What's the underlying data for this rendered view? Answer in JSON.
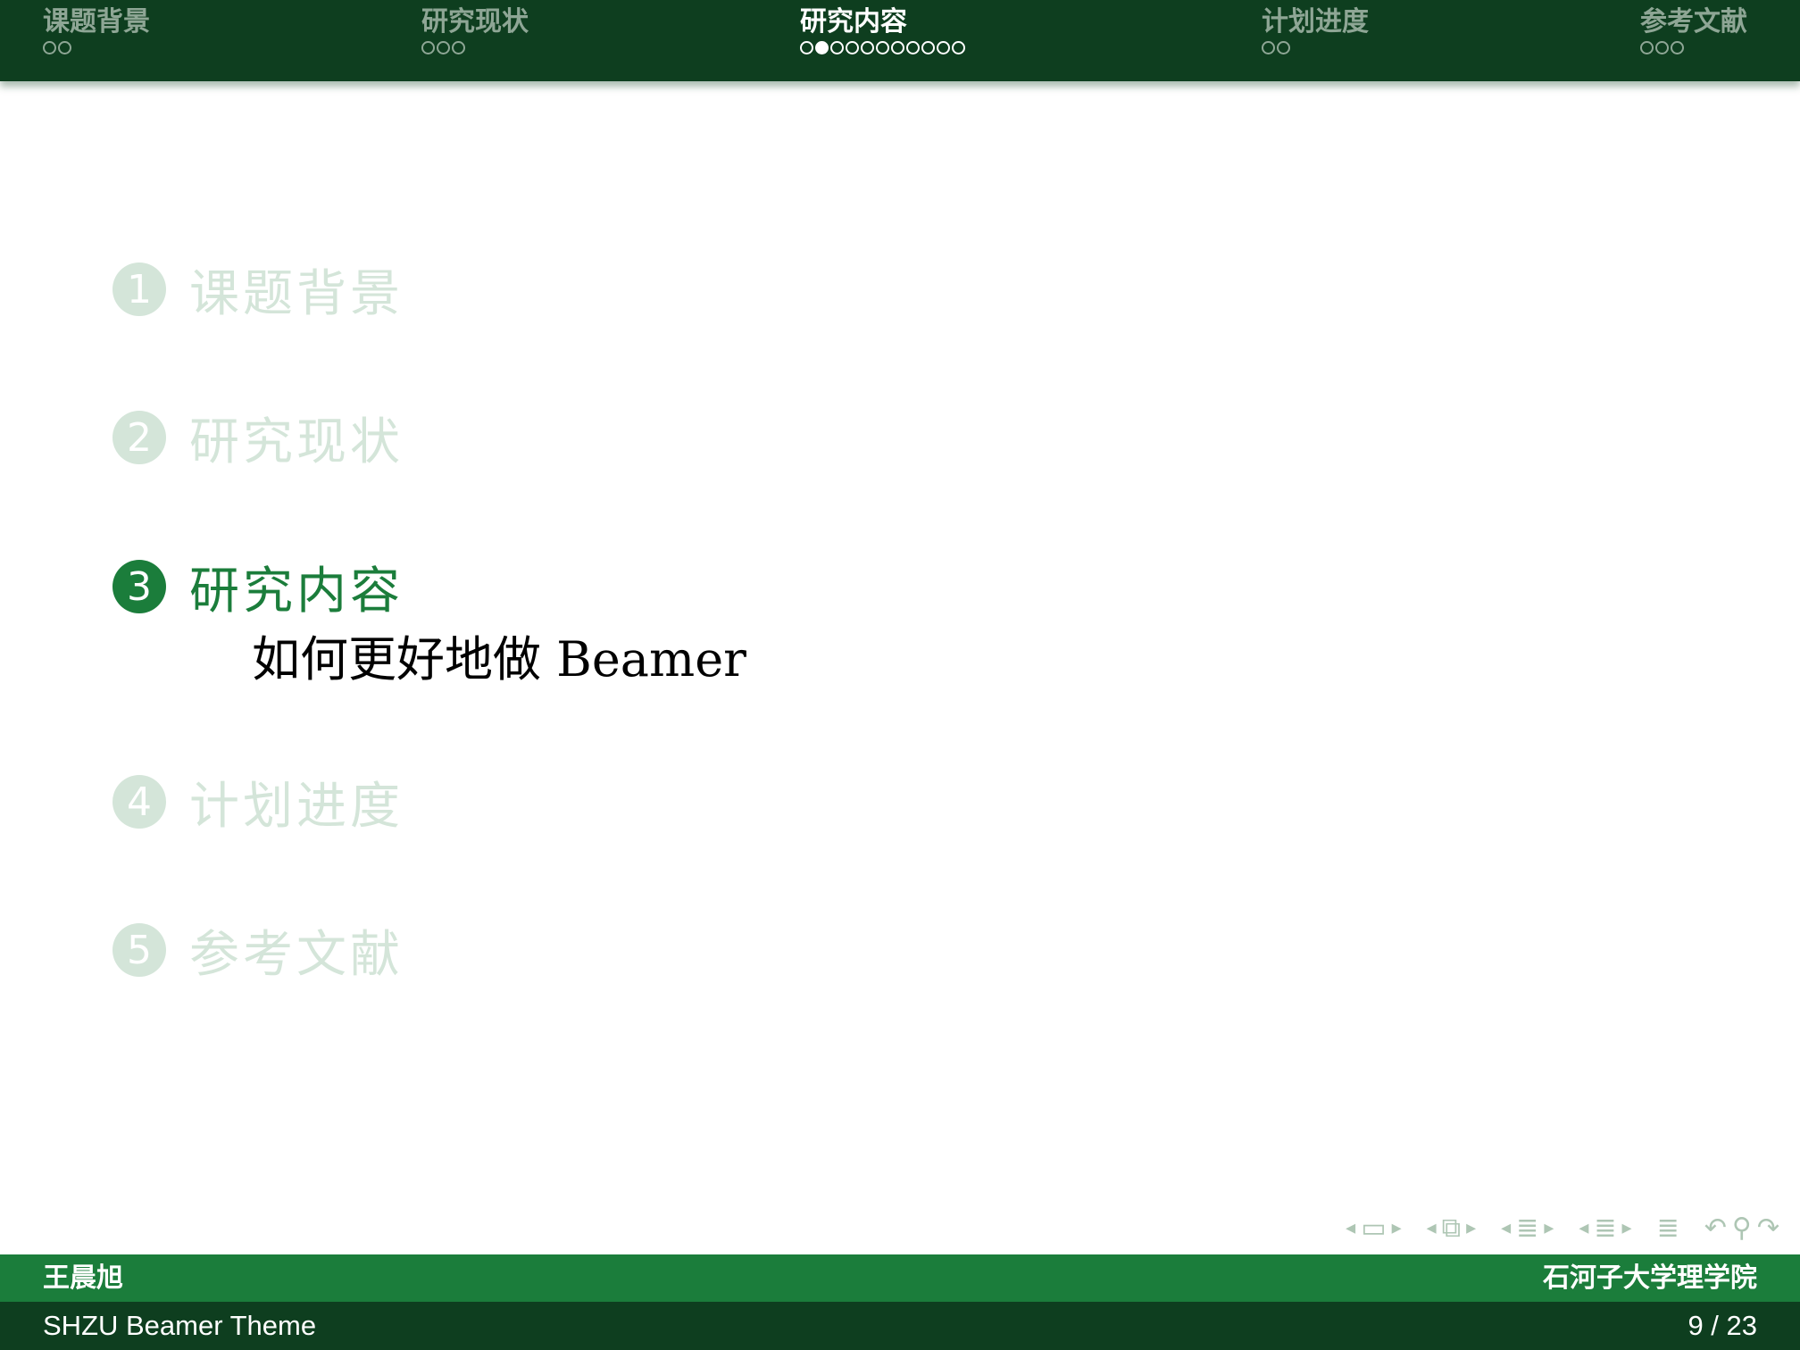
{
  "header": {
    "sections": [
      {
        "title": "课题背景",
        "dots": 2,
        "current_dot": -1
      },
      {
        "title": "研究现状",
        "dots": 3,
        "current_dot": -1
      },
      {
        "title": "研究内容",
        "dots": 11,
        "current_dot": 1
      },
      {
        "title": "计划进度",
        "dots": 2,
        "current_dot": -1
      },
      {
        "title": "参考文献",
        "dots": 3,
        "current_dot": -1
      }
    ],
    "active_section": 2
  },
  "outline": {
    "items": [
      {
        "number": "1",
        "label": "课题背景"
      },
      {
        "number": "2",
        "label": "研究现状"
      },
      {
        "number": "3",
        "label": "研究内容"
      },
      {
        "number": "4",
        "label": "计划进度"
      },
      {
        "number": "5",
        "label": "参考文献"
      }
    ],
    "active_index": 2,
    "subsection": "如何更好地做 Beamer"
  },
  "footer": {
    "author": "王晨旭",
    "institute": "石河子大学理学院",
    "short_title": "SHZU Beamer Theme",
    "page": "9 / 23"
  },
  "nav_icons": [
    "frame-nav-icon",
    "subsection-nav-icon",
    "section-nav-icon",
    "presentation-nav-icon",
    "appendix-icon",
    "back-icon",
    "search-icon",
    "forward-icon"
  ],
  "colors": {
    "header_bg": "#0e3e1f",
    "footer_top_bg": "#1b7d3b",
    "footer_bottom_bg": "#0e3e1f",
    "accent": "#1b7d3b",
    "inactive": "#d4e5d9"
  }
}
